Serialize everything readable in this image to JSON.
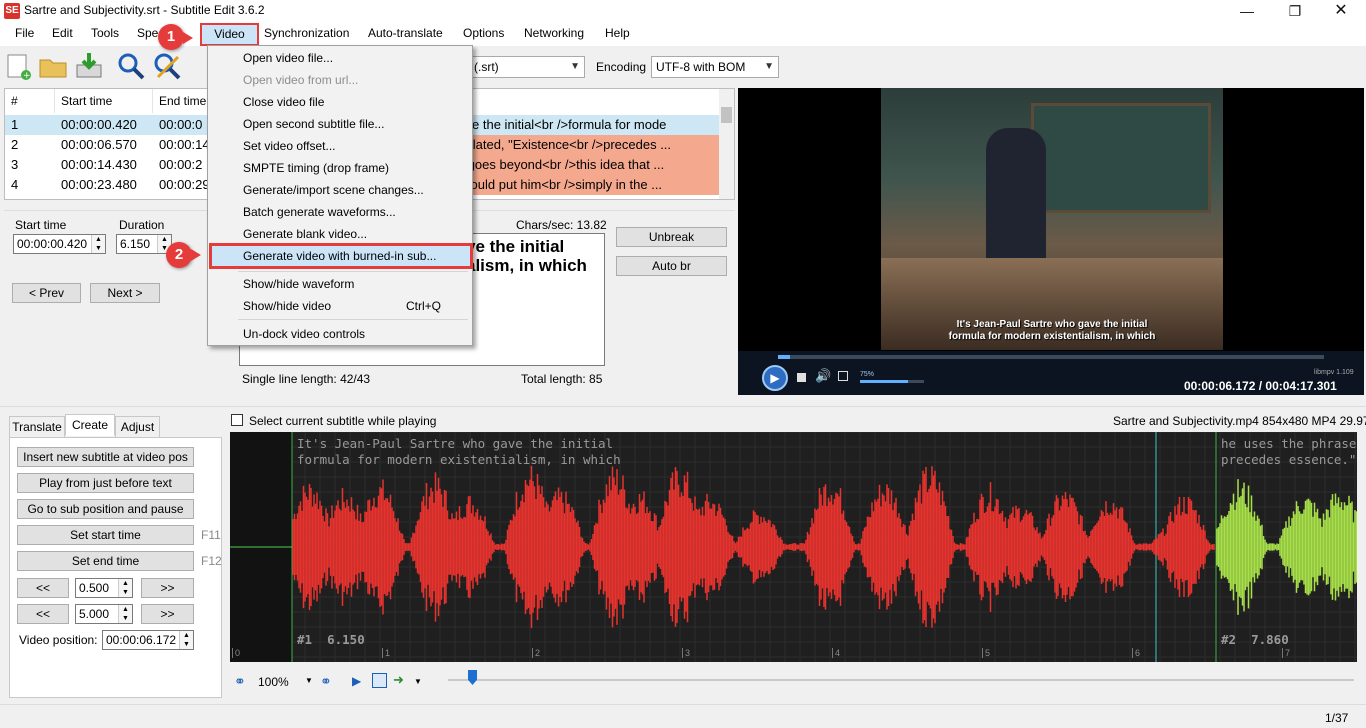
{
  "window": {
    "title": "Sartre and Subjectivity.srt - Subtitle Edit 3.6.2",
    "icon_text": "SE"
  },
  "menu": [
    "File",
    "Edit",
    "Tools",
    "Spe",
    "Video",
    "Synchronization",
    "Auto-translate",
    "Options",
    "Networking",
    "Help"
  ],
  "toolbar": {
    "format_value": "o (.srt)",
    "encoding_label": "Encoding",
    "encoding_value": "UTF-8 with BOM"
  },
  "list": {
    "headers": [
      "#",
      "Start time",
      "End time"
    ],
    "rows": [
      {
        "num": "1",
        "start": "00:00:00.420",
        "end": "00:00:0",
        "text": "ho gave the initial<br />formula for mode"
      },
      {
        "num": "2",
        "start": "00:00:06.570",
        "end": "00:00:14",
        "text": "g translated, \"Existence<br />precedes ..."
      },
      {
        "num": "3",
        "start": "00:00:14.430",
        "end": "00:00:2",
        "text": "nking goes beyond<br />this idea that ..."
      },
      {
        "num": "4",
        "start": "00:00:23.480",
        "end": "00:00:29",
        "text": "-this would put him<br />simply in the ..."
      }
    ]
  },
  "edit": {
    "start_time_label": "Start time",
    "start_time_value": "00:00:00.420",
    "duration_label": "Duration",
    "duration_value": "6.150",
    "prev_label": "< Prev",
    "next_label": "Next >",
    "chars_sec": "Chars/sec: 13.82",
    "text_line1": "ve the initial",
    "text_line2": "alism, in which",
    "single_line_length": "Single line length: 42/43",
    "total_length": "Total length: 85",
    "unbreak_label": "Unbreak",
    "autobr_label": "Auto br"
  },
  "video": {
    "subtitle_line1": "It's Jean-Paul Sartre who gave the initial",
    "subtitle_line2": "formula for modern existentialism, in which",
    "volume": "75%",
    "volume_level": 0.75,
    "engine": "libmpv 1.109",
    "time": "00:00:06.172 / 00:04:17.301"
  },
  "video_menu": {
    "items": [
      {
        "label": "Open video file...",
        "enabled": true
      },
      {
        "label": "Open video from url...",
        "enabled": false
      },
      {
        "label": "Close video file",
        "enabled": true
      },
      {
        "label": "Open second subtitle file...",
        "enabled": true
      },
      {
        "label": "Set video offset...",
        "enabled": true
      },
      {
        "label": "SMPTE timing (drop frame)",
        "enabled": true
      },
      {
        "label": "Generate/import scene changes...",
        "enabled": true
      },
      {
        "label": "Batch generate waveforms...",
        "enabled": true
      },
      {
        "label": "Generate blank video...",
        "enabled": true
      },
      {
        "label": "Generate video with burned-in sub...",
        "enabled": true,
        "highlighted": true
      },
      {
        "label": "Show/hide waveform",
        "enabled": true
      },
      {
        "label": "Show/hide video",
        "enabled": true,
        "shortcut": "Ctrl+Q"
      },
      {
        "label": "Un-dock video controls",
        "enabled": true
      }
    ]
  },
  "callouts": [
    "1",
    "2"
  ],
  "bottom": {
    "tabs": [
      "Translate",
      "Create",
      "Adjust"
    ],
    "select_current": "Select current subtitle while playing",
    "media_info": "Sartre and Subjectivity.mp4 854x480 MP4 29.97",
    "buttons": {
      "insert": "Insert new subtitle at video pos",
      "play_before": "Play from just before text",
      "goto_sub": "Go to sub position and pause",
      "set_start": "Set start time",
      "set_start_key": "F11",
      "set_end": "Set end time",
      "set_end_key": "F12",
      "back": "<<",
      "fwd": ">>",
      "step1": "0.500",
      "step2": "5.000",
      "video_position_label": "Video position:",
      "video_position": "00:00:06.172"
    },
    "waveform": {
      "sub1_line1": "It's Jean-Paul Sartre who gave the initial",
      "sub1_line2": "formula for modern existentialism, in which",
      "sub1_tag": "#1  6.150",
      "sub2_line1": "he uses the phrase be",
      "sub2_line2": "precedes essence.\"",
      "sub2_tag": "#2  7.860",
      "ticks": [
        "0",
        "1",
        "2",
        "3",
        "4",
        "5",
        "6",
        "7"
      ]
    },
    "zoom": "100%"
  },
  "status": {
    "position": "1/37"
  },
  "colors": {
    "accent_red": "#e53b3b",
    "wave_red": "#e8332e",
    "wave_green": "#a8e04a",
    "row_selected": "#cde8f4",
    "row_error": "#f4a98f"
  }
}
